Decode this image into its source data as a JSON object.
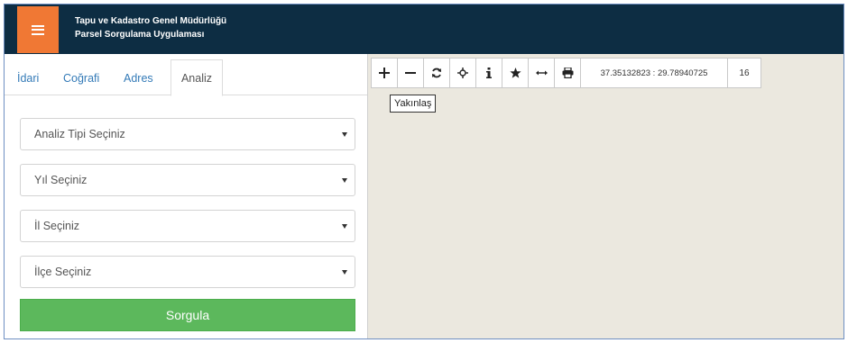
{
  "header": {
    "title_line1": "Tapu ve Kadastro Genel Müdürlüğü",
    "title_line2": "Parsel Sorgulama Uygulaması",
    "menu_icon": "hamburger-menu-icon",
    "accent_color": "#f07834",
    "bar_color": "#0d2d43"
  },
  "tabs": {
    "items": [
      "İdari",
      "Coğrafi",
      "Adres",
      "Analiz"
    ],
    "active": "Analiz"
  },
  "form": {
    "analysis_type": "Analiz Tipi Seçiniz",
    "year": "Yıl Seçiniz",
    "province": "İl Seçiniz",
    "district": "İlçe Seçiniz",
    "submit_label": "Sorgula",
    "submit_color": "#5cb85c"
  },
  "map": {
    "toolbar_icons": [
      "zoom-in-icon",
      "zoom-out-icon",
      "refresh-icon",
      "locate-icon",
      "info-icon",
      "star-icon",
      "measure-icon",
      "print-icon"
    ],
    "coordinates": "37.35132823 : 29.78940725",
    "zoom_level": "16",
    "tooltip": "Yakınlaş"
  }
}
